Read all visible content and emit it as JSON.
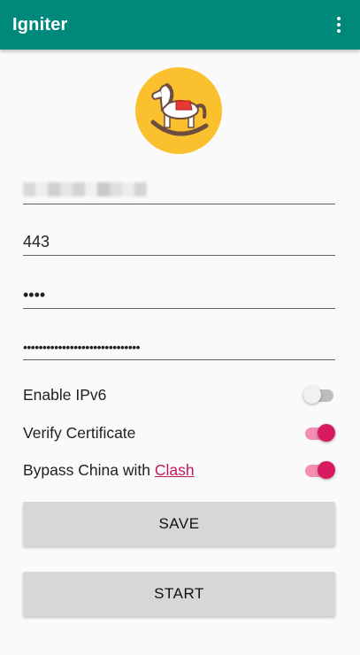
{
  "app": {
    "title": "Igniter",
    "menu_icon": "overflow-menu-icon"
  },
  "logo": {
    "icon": "rocking-horse-icon",
    "bg_color": "#fbc02d"
  },
  "form": {
    "host_value": "",
    "port_value": "443",
    "password_value": "••••",
    "password2_value": "••••••••••••••••••••••••••••••"
  },
  "toggles": [
    {
      "label": "Enable IPv6",
      "on": false
    },
    {
      "label": "Verify Certificate",
      "on": true
    },
    {
      "label_prefix": "Bypass China with ",
      "link_text": "Clash",
      "on": true
    }
  ],
  "buttons": {
    "save_label": "SAVE",
    "start_label": "START"
  },
  "colors": {
    "primary": "#00897b",
    "accent": "#d81b60",
    "link": "#c2185b"
  }
}
